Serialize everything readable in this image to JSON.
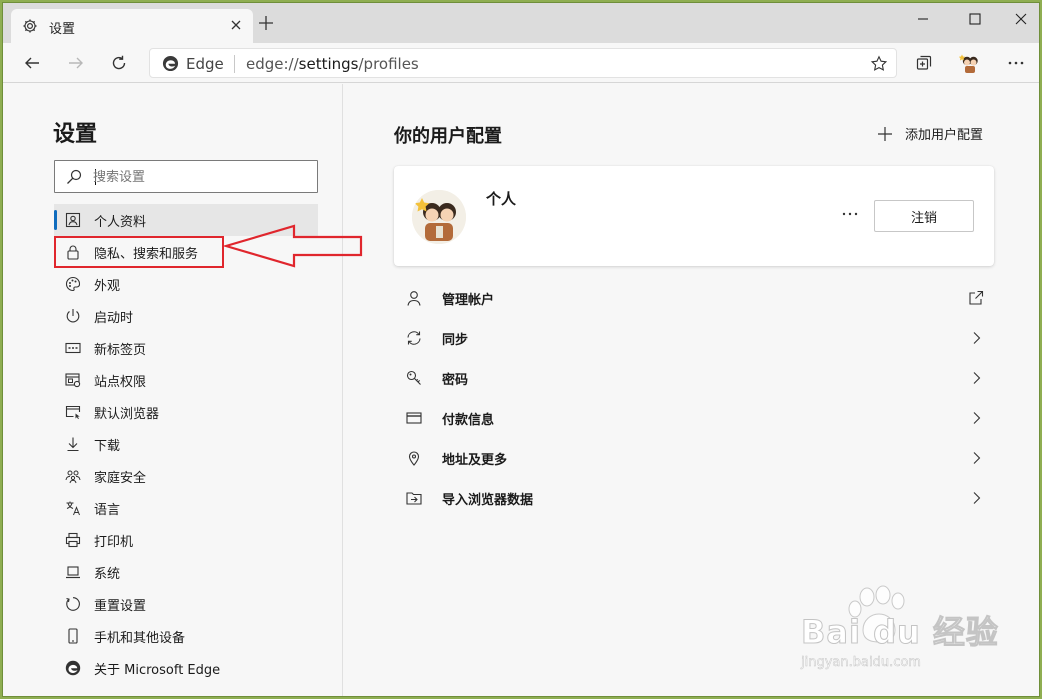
{
  "tab": {
    "title": "设置"
  },
  "address": {
    "brand": "Edge",
    "url_prefix": "edge://",
    "url_host": "settings",
    "url_path": "/profiles"
  },
  "sidebar": {
    "title": "设置",
    "search_placeholder": "搜索设置",
    "items": [
      {
        "label": "个人资料",
        "icon": "profile-icon",
        "active": true
      },
      {
        "label": "隐私、搜索和服务",
        "icon": "lock-icon",
        "highlighted": true
      },
      {
        "label": "外观",
        "icon": "palette-icon"
      },
      {
        "label": "启动时",
        "icon": "power-icon"
      },
      {
        "label": "新标签页",
        "icon": "new-tab-page-icon"
      },
      {
        "label": "站点权限",
        "icon": "site-permissions-icon"
      },
      {
        "label": "默认浏览器",
        "icon": "default-browser-icon"
      },
      {
        "label": "下载",
        "icon": "download-icon"
      },
      {
        "label": "家庭安全",
        "icon": "family-icon"
      },
      {
        "label": "语言",
        "icon": "language-icon"
      },
      {
        "label": "打印机",
        "icon": "printer-icon"
      },
      {
        "label": "系统",
        "icon": "system-icon"
      },
      {
        "label": "重置设置",
        "icon": "reset-icon"
      },
      {
        "label": "手机和其他设备",
        "icon": "phone-icon"
      },
      {
        "label": "关于 Microsoft Edge",
        "icon": "edge-logo-icon"
      }
    ]
  },
  "main": {
    "heading": "你的用户配置",
    "add_profile_label": "添加用户配置",
    "profile": {
      "name": "个人",
      "signout_label": "注销"
    },
    "rows": [
      {
        "label": "管理帐户",
        "icon": "person-icon",
        "trail": "external-link-icon"
      },
      {
        "label": "同步",
        "icon": "sync-icon",
        "trail": "chevron-right-icon"
      },
      {
        "label": "密码",
        "icon": "key-icon",
        "trail": "chevron-right-icon"
      },
      {
        "label": "付款信息",
        "icon": "card-icon",
        "trail": "chevron-right-icon"
      },
      {
        "label": "地址及更多",
        "icon": "location-icon",
        "trail": "chevron-right-icon"
      },
      {
        "label": "导入浏览器数据",
        "icon": "import-icon",
        "trail": "chevron-right-icon"
      }
    ]
  },
  "watermark": {
    "brand": "Bai du 经验",
    "url": "jingyan.baidu.com"
  },
  "colors": {
    "accent": "#0f6cbd",
    "annotation_red": "#e0262d",
    "desktop_green": "#8fae52"
  }
}
